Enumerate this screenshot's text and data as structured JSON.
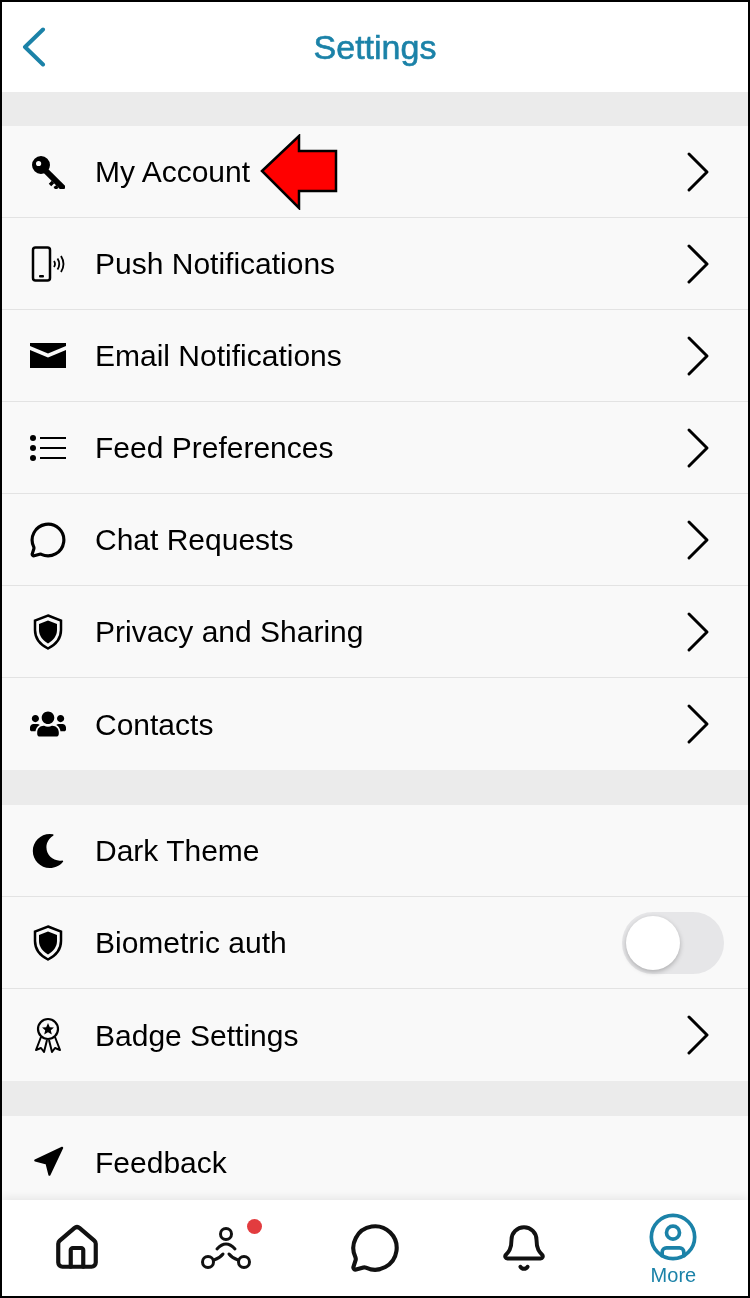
{
  "header": {
    "title": "Settings"
  },
  "sections": [
    {
      "items": [
        {
          "kind": "link",
          "label": "My Account",
          "pointed_at": true
        },
        {
          "kind": "link",
          "label": "Push Notifications",
          "pointed_at": false
        },
        {
          "kind": "link",
          "label": "Email Notifications",
          "pointed_at": false
        },
        {
          "kind": "link",
          "label": "Feed Preferences",
          "pointed_at": false
        },
        {
          "kind": "link",
          "label": "Chat Requests",
          "pointed_at": false
        },
        {
          "kind": "link",
          "label": "Privacy and Sharing",
          "pointed_at": false
        },
        {
          "kind": "link",
          "label": "Contacts",
          "pointed_at": false
        }
      ]
    },
    {
      "items": [
        {
          "kind": "plain",
          "label": "Dark Theme",
          "pointed_at": false
        },
        {
          "kind": "toggle",
          "label": "Biometric auth",
          "on": false,
          "pointed_at": false
        },
        {
          "kind": "link",
          "label": "Badge Settings",
          "pointed_at": false
        }
      ]
    },
    {
      "items": [
        {
          "kind": "plain",
          "label": "Feedback",
          "pointed_at": false
        }
      ]
    }
  ],
  "tab_bar": [
    {
      "selected": false,
      "badge": false
    },
    {
      "selected": false,
      "badge": true
    },
    {
      "selected": false,
      "badge": false
    },
    {
      "selected": false,
      "badge": false
    },
    {
      "selected": true,
      "badge": false,
      "label": "More"
    }
  ]
}
